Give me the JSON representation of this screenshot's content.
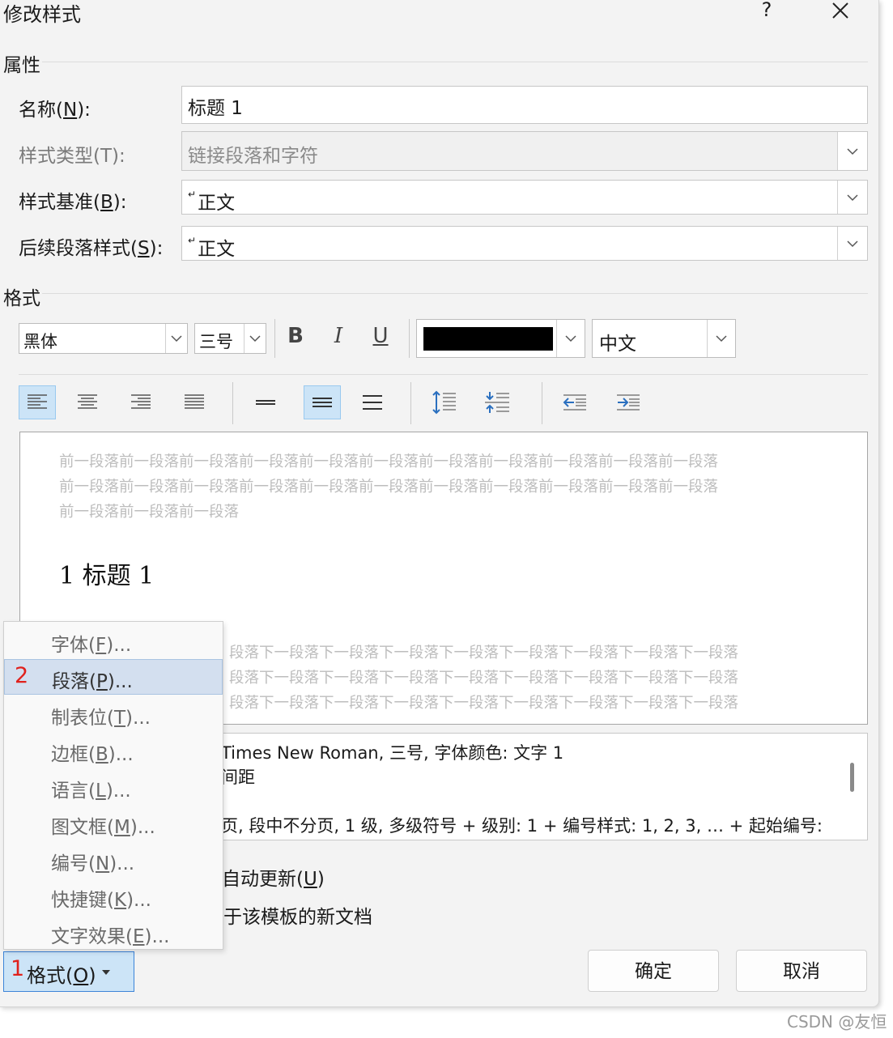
{
  "dialog": {
    "title": "修改样式",
    "help": "?"
  },
  "properties": {
    "section": "属性",
    "name_label_pre": "名称(",
    "name_label_key": "N",
    "name_label_post": "):",
    "name_value": "标题 1",
    "type_label": "样式类型(T):",
    "type_value": "链接段落和字符",
    "based_label_pre": "样式基准(",
    "based_label_key": "B",
    "based_label_post": "):",
    "based_value": "正文",
    "next_label_pre": "后续段落样式(",
    "next_label_key": "S",
    "next_label_post": "):",
    "next_value": "正文",
    "para_mark": "↵"
  },
  "format": {
    "section": "格式",
    "font": "黑体",
    "size": "三号",
    "bold": "B",
    "italic": "I",
    "underline": "U",
    "font_color": "#000000",
    "script": "中文"
  },
  "preview": {
    "before_lines": [
      "前一段落前一段落前一段落前一段落前一段落前一段落前一段落前一段落前一段落前一段落前一段落",
      "前一段落前一段落前一段落前一段落前一段落前一段落前一段落前一段落前一段落前一段落前一段落",
      "前一段落前一段落前一段落"
    ],
    "heading": "1 标题 1",
    "after_lines": [
      "段落下一段落下一段落下一段落下一段落下一段落下一段落下一段落下一段落",
      "段落下一段落下一段落下一段落下一段落下一段落下一段落下一段落下一段落",
      "段落下一段落下一段落下一段落下一段落下一段落下一段落下一段落下一段落"
    ]
  },
  "description": {
    "line1": "Times New Roman, 三号, 字体颜色: 文字 1",
    "line2": "间距",
    "line3": "页, 段中不分页, 1 级, 多级符号 + 级别: 1 + 编号样式: 1, 2, 3, … + 起始编号:"
  },
  "options": {
    "auto_update_pre": "自动更新(",
    "auto_update_key": "U",
    "auto_update_post": ")",
    "template": "于该模板的新文档"
  },
  "buttons": {
    "format_pre": "格式(",
    "format_key": "O",
    "format_post": ")",
    "ok": "确定",
    "cancel": "取消"
  },
  "menu": {
    "items": [
      {
        "pre": "字体(",
        "key": "F",
        "post": ")..."
      },
      {
        "pre": "段落(",
        "key": "P",
        "post": ")..."
      },
      {
        "pre": "制表位(",
        "key": "T",
        "post": ")..."
      },
      {
        "pre": "边框(",
        "key": "B",
        "post": ")..."
      },
      {
        "pre": "语言(",
        "key": "L",
        "post": ")..."
      },
      {
        "pre": "图文框(",
        "key": "M",
        "post": ")..."
      },
      {
        "pre": "编号(",
        "key": "N",
        "post": ")..."
      },
      {
        "pre": "快捷键(",
        "key": "K",
        "post": ")..."
      },
      {
        "pre": "文字效果(",
        "key": "E",
        "post": ")..."
      }
    ]
  },
  "annotations": {
    "step1": "1",
    "step2": "2"
  },
  "watermark": "CSDN @友恒"
}
